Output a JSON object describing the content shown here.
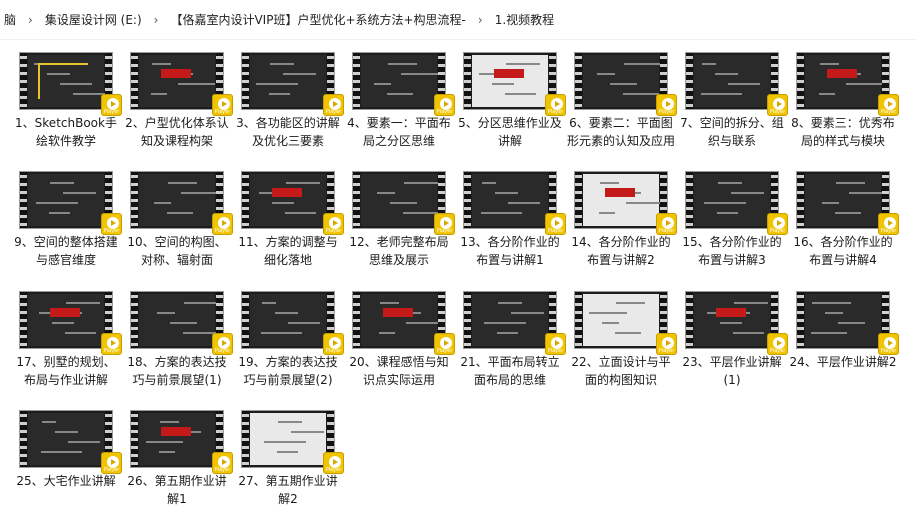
{
  "address_bar": {
    "crumbs": [
      "脑",
      "集设屋设计网 (E:)",
      "【佫嘉室内设计VIP班】户型优化+系统方法+构思流程-",
      "1.视频教程"
    ],
    "separator": "›"
  },
  "player_badge": "Player",
  "files": [
    "1、SketchBook手绘软件教学",
    "2、户型优化体系认知及课程构架",
    "3、各功能区的讲解及优化三要素",
    "4、要素一：平面布局之分区思维",
    "5、分区思维作业及讲解",
    "6、要素二：平面图形元素的认知及应用",
    "7、空间的拆分、组织与联系",
    "8、要素三：优秀布局的样式与模块",
    "9、空间的整体搭建与感官维度",
    "10、空间的构图、对称、辐射面",
    "11、方案的调整与细化落地",
    "12、老师完整布局思维及展示",
    "13、各分阶作业的布置与讲解1",
    "14、各分阶作业的布置与讲解2",
    "15、各分阶作业的布置与讲解3",
    "16、各分阶作业的布置与讲解4",
    "17、别墅的规划、布局与作业讲解",
    "18、方案的表达技巧与前景展望(1)",
    "19、方案的表达技巧与前景展望(2)",
    "20、课程感悟与知识点实际运用",
    "21、平面布局转立面布局的思维",
    "22、立面设计与平面的构图知识",
    "23、平层作业讲解 (1)",
    "24、平层作业讲解2",
    "25、大宅作业讲解",
    "26、第五期作业讲解1",
    "27、第五期作业讲解2"
  ]
}
